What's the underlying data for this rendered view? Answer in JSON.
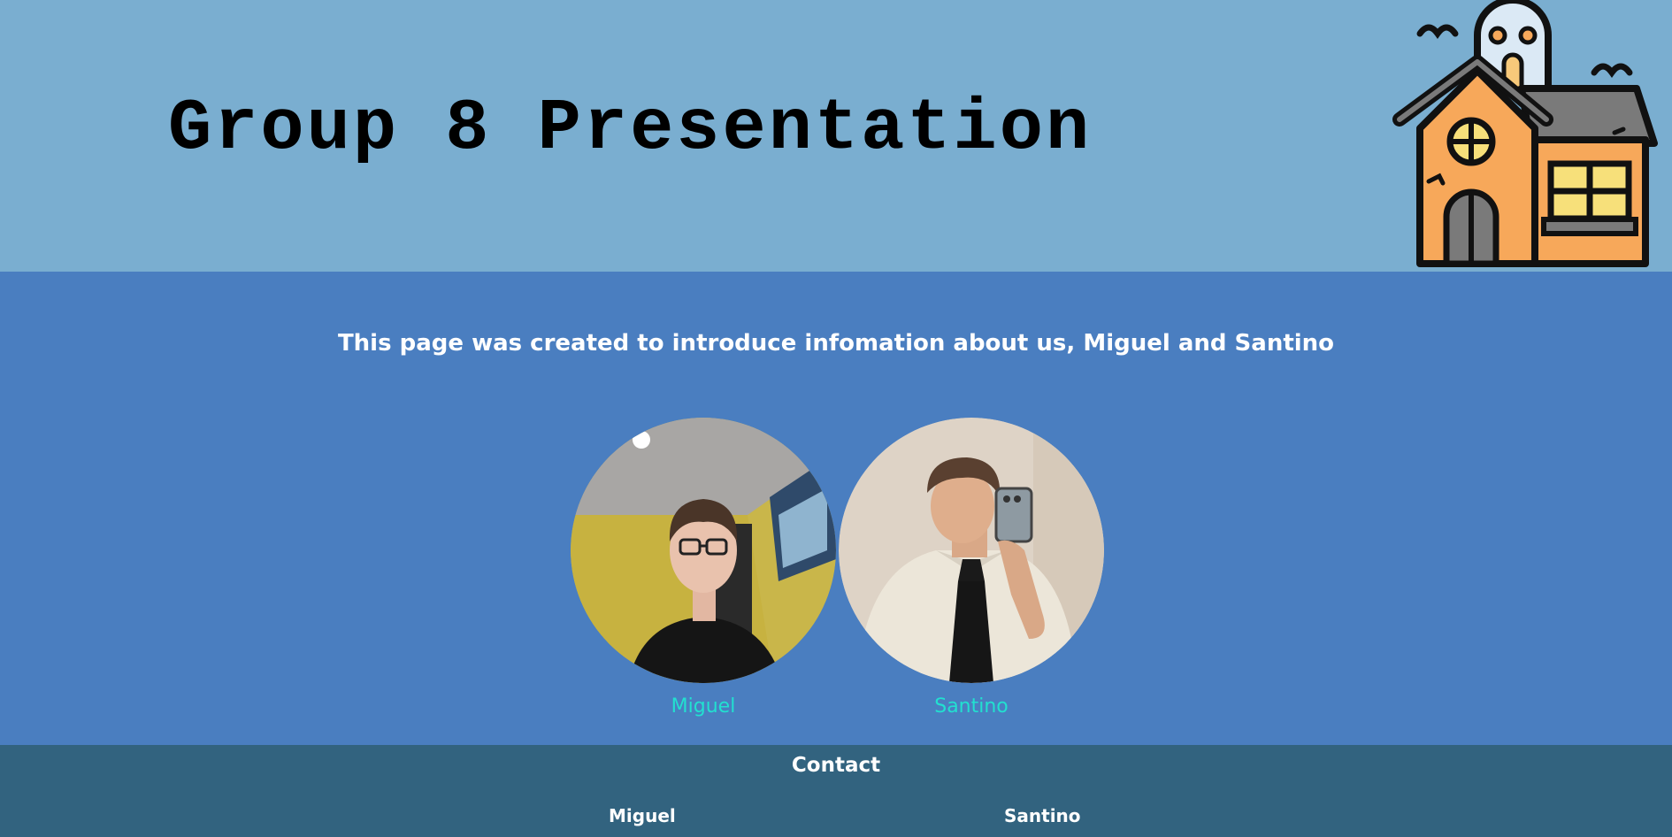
{
  "header": {
    "title": "Group 8 Presentation",
    "logo_icon": "haunted-house-icon"
  },
  "main": {
    "intro_text": "This page was created to introduce infomation about us, Miguel and Santino",
    "people": [
      {
        "name": "Miguel",
        "photo": "miguel-photo"
      },
      {
        "name": "Santino",
        "photo": "santino-photo"
      }
    ]
  },
  "footer": {
    "heading": "Contact",
    "contacts": [
      {
        "name": "Miguel"
      },
      {
        "name": "Santino"
      }
    ]
  },
  "colors": {
    "header_bg": "#7aaed0",
    "main_bg": "#4a7ec0",
    "footer_bg": "#32637f",
    "name_link": "#22e0d0"
  }
}
